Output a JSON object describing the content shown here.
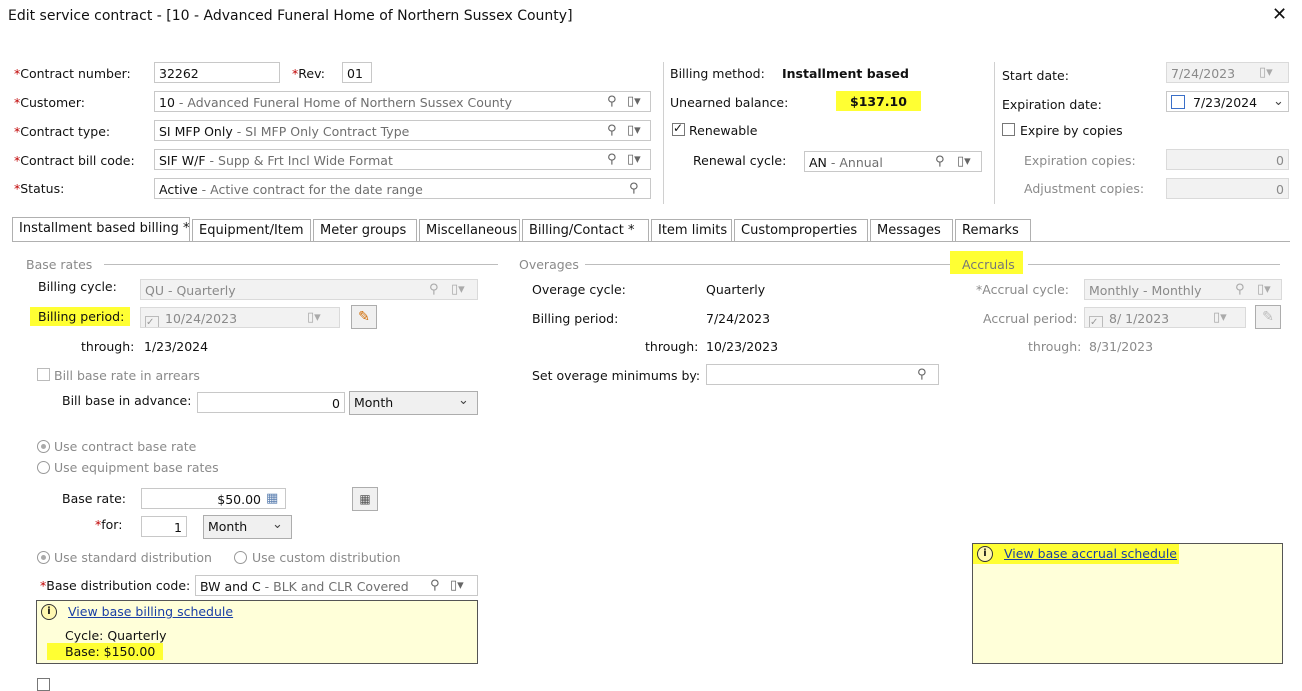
{
  "window": {
    "title": "Edit service contract - [10 - Advanced Funeral Home of Northern Sussex County]"
  },
  "header": {
    "contract_number_label": "Contract number:",
    "contract_number": "32262",
    "rev_label": "Rev:",
    "rev": "01",
    "customer_label": "Customer:",
    "customer_code": "10",
    "customer_desc": " - Advanced Funeral Home of Northern Sussex County",
    "contract_type_label": "Contract type:",
    "contract_type_code": "SI MFP Only",
    "contract_type_desc": " - SI MFP Only Contract Type",
    "bill_code_label": "Contract bill code:",
    "bill_code_code": "SIF W/F",
    "bill_code_desc": " - Supp & Frt Incl Wide Format",
    "status_label": "Status:",
    "status_code": "Active",
    "status_desc": " - Active contract for the date range",
    "billing_method_label": "Billing method:",
    "billing_method": "Installment based",
    "unearned_label": "Unearned balance:",
    "unearned": "$137.10",
    "renewable_label": "Renewable",
    "renewal_cycle_label": "Renewal cycle:",
    "renewal_code": "AN",
    "renewal_desc": " - Annual",
    "start_date_label": "Start date:",
    "start_date": "7/24/2023",
    "expiration_date_label": "Expiration date:",
    "expiration_date": "7/23/2024",
    "expire_by_copies_label": "Expire by copies",
    "expiration_copies_label": "Expiration copies:",
    "expiration_copies": "0",
    "adjustment_copies_label": "Adjustment copies:",
    "adjustment_copies": "0"
  },
  "tabs": [
    "Installment based billing *",
    "Equipment/Item",
    "Meter groups",
    "Miscellaneous",
    "Billing/Contact *",
    "Item limits",
    "Customproperties",
    "Messages",
    "Remarks"
  ],
  "base_rates": {
    "group_label": "Base rates",
    "billing_cycle_label": "Billing cycle:",
    "billing_cycle": "QU - Quarterly",
    "billing_period_label": "Billing period:",
    "billing_period": "10/24/2023",
    "through_label": "through:",
    "through": "1/23/2024",
    "arrears_label": "Bill base rate in arrears",
    "advance_label": "Bill base in advance:",
    "advance_value": "0",
    "advance_unit": "Month",
    "use_contract_rate": "Use contract base rate",
    "use_equipment_rates": "Use equipment base rates",
    "base_rate_label": "Base rate:",
    "base_rate": "$50.00",
    "for_label": "for:",
    "for_value": "1",
    "for_unit": "Month",
    "standard_dist": "Use standard distribution",
    "custom_dist": "Use custom distribution",
    "dist_code_label": "Base distribution code:",
    "dist_code": "BW and C",
    "dist_desc": " - BLK and CLR Covered",
    "schedule_link": "View base billing schedule",
    "cycle_text": "Cycle: Quarterly",
    "base_text": "Base: $150.00"
  },
  "overages": {
    "group_label": "Overages",
    "cycle_label": "Overage cycle:",
    "cycle": "Quarterly",
    "period_label": "Billing period:",
    "period": "7/24/2023",
    "through_label": "through:",
    "through": "10/23/2023",
    "minimums_label": "Set overage minimums by:"
  },
  "accruals": {
    "group_label": "Accruals",
    "cycle_label": "Accrual cycle:",
    "cycle": "Monthly - Monthly",
    "period_label": "Accrual period:",
    "period": "8/ 1/2023",
    "through_label": "through:",
    "through": "8/31/2023",
    "schedule_link": "View base accrual schedule"
  }
}
